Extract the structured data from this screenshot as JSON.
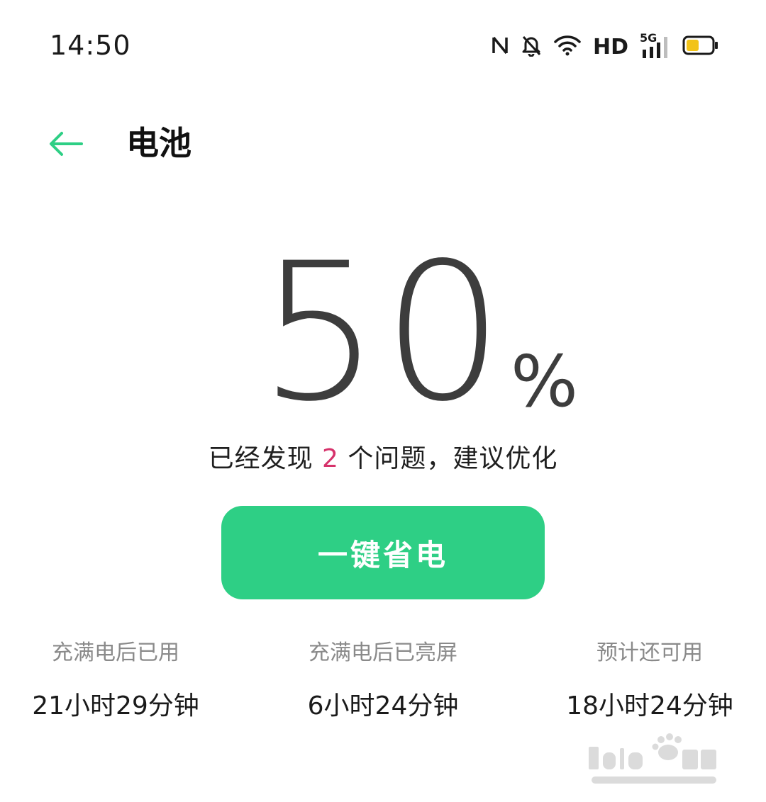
{
  "status_bar": {
    "time": "14:50",
    "network_label": "HD",
    "cellular_label": "5G",
    "icons": [
      "nfc-icon",
      "bell-muted-icon",
      "wifi-icon",
      "signal-icon",
      "battery-icon"
    ],
    "battery_color": "#f2c318"
  },
  "header": {
    "back_icon": "arrow-left-icon",
    "title": "电池",
    "accent_color": "#2ecf85"
  },
  "battery": {
    "percent": "50",
    "percent_sign": "%",
    "level": 50
  },
  "issues": {
    "prefix": "已经发现 ",
    "count": "2",
    "suffix": " 个问题，建议优化",
    "count_color": "#d6326b"
  },
  "save_button": {
    "label": "一键省电",
    "color": "#2ecf85"
  },
  "stats": [
    {
      "label": "充满电后已用",
      "value": "21小时29分钟"
    },
    {
      "label": "充满电后已亮屏",
      "value": "6小时24分钟"
    },
    {
      "label": "预计还可用",
      "value": "18小时24分钟"
    }
  ],
  "watermark": {
    "icon": "baidu-jingyan-logo"
  }
}
